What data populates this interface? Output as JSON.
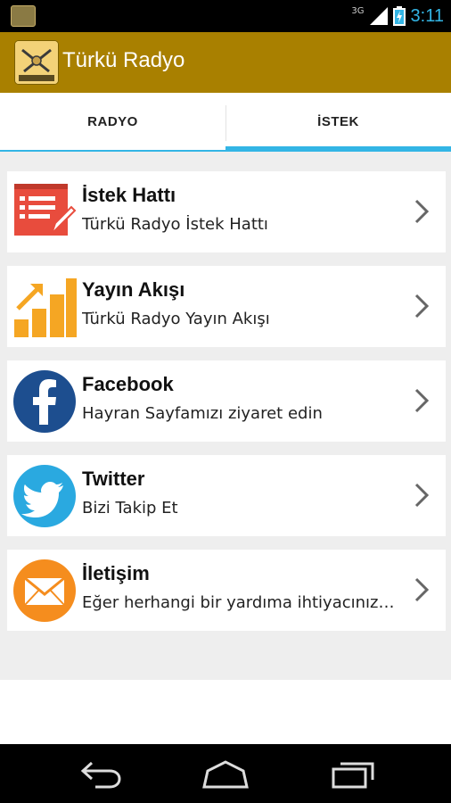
{
  "status_bar": {
    "network": "3G",
    "time": "3:11"
  },
  "action_bar": {
    "title": "Türkü Radyo",
    "icon": "app-logo-icon"
  },
  "tabs": [
    {
      "label": "RADYO",
      "active": false
    },
    {
      "label": "İSTEK",
      "active": true
    }
  ],
  "list": [
    {
      "title": "İstek Hattı",
      "subtitle": "Türkü Radyo İstek Hattı",
      "icon": "request-form-icon",
      "color": "#e84c3d"
    },
    {
      "title": "Yayın Akışı",
      "subtitle": "Türkü Radyo Yayın Akışı",
      "icon": "bar-chart-icon",
      "color": "#f5a623"
    },
    {
      "title": "Facebook",
      "subtitle": "Hayran Sayfamızı ziyaret edin",
      "icon": "facebook-icon",
      "color": "#1d4e8f"
    },
    {
      "title": "Twitter",
      "subtitle": "Bizi Takip Et",
      "icon": "twitter-icon",
      "color": "#2aa9e0"
    },
    {
      "title": "İletişim",
      "subtitle": "Eğer herhangi bir yardıma ihtiyacınız olursa bize ulaşın",
      "icon": "mail-icon",
      "color": "#f58d1e"
    }
  ],
  "colors": {
    "action_bar": "#a98000",
    "accent": "#33b5e5"
  }
}
